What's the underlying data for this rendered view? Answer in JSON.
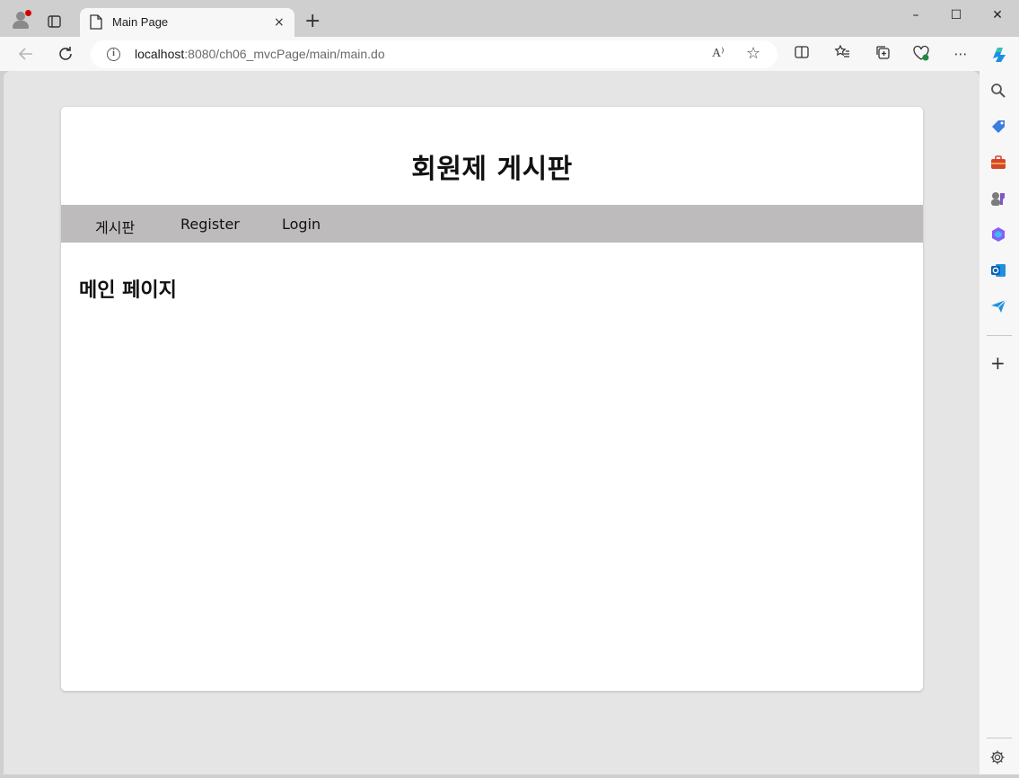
{
  "browser": {
    "tab": {
      "title": "Main Page",
      "close_glyph": "×"
    },
    "new_tab_glyph": "+",
    "window": {
      "minimize": "–",
      "maximize": "☐",
      "close": "✕"
    },
    "address": {
      "host": "localhost",
      "path": ":8080/ch06_mvcPage/main/main.do",
      "info_glyph": "i",
      "read_aloud_glyph": "A⁾"
    },
    "sidebar_icons": [
      "copilot-icon",
      "search-icon",
      "shopping-tag-icon",
      "tools-icon",
      "games-icon",
      "microsoft365-icon",
      "outlook-icon",
      "send-icon",
      "add-icon",
      "settings-icon"
    ]
  },
  "site": {
    "title": "회원제 게시판",
    "menu": [
      {
        "label": "게시판"
      },
      {
        "label": "Register"
      },
      {
        "label": "Login"
      }
    ],
    "heading": "메인 페이지"
  },
  "colors": {
    "menu_bar": "#bdbbbb",
    "viewport_bg": "#e5e5e5",
    "card_bg": "#ffffff"
  }
}
